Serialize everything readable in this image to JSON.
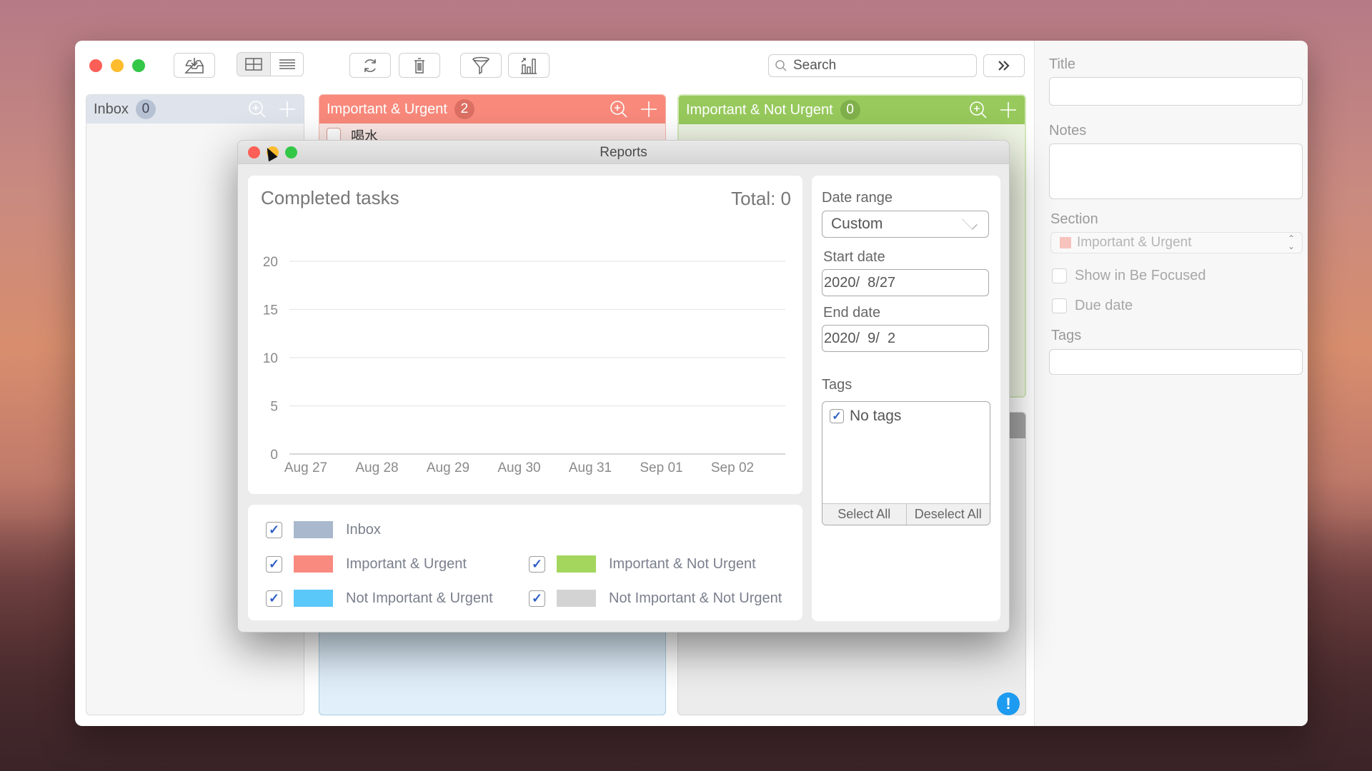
{
  "toolbar": {
    "search_placeholder": "Search",
    "icons": [
      "inbox-download-icon",
      "grid-view-icon",
      "list-view-icon",
      "refresh-icon",
      "trash-icon",
      "filter-icon",
      "reports-chart-icon",
      "expand-panel-icon"
    ]
  },
  "columns": {
    "inbox": {
      "label": "Inbox",
      "count": "0",
      "color": "#dfe4ec"
    },
    "important_urgent": {
      "label": "Important & Urgent",
      "count": "2",
      "color": "#f8897b",
      "tasks": [
        {
          "title": "喝水",
          "done": false
        }
      ]
    },
    "important_not_urgent": {
      "label": "Important & Not Urgent",
      "count": "0",
      "color": "#97c95c"
    }
  },
  "detail_panel": {
    "title_label": "Title",
    "title_value": "",
    "notes_label": "Notes",
    "notes_value": "",
    "section_label": "Section",
    "section_value": "Important & Urgent",
    "section_color": "#f7c3bd",
    "show_in_be_focused_label": "Show in Be Focused",
    "show_in_be_focused": false,
    "due_date_label": "Due date",
    "due_date": false,
    "tags_label": "Tags",
    "tags_value": ""
  },
  "reports": {
    "window_title": "Reports",
    "chart_title": "Completed tasks",
    "total_label": "Total: 0",
    "legend": [
      {
        "label": "Inbox",
        "color": "#a9b8cc",
        "checked": true
      },
      {
        "label": "Important & Urgent",
        "color": "#f98a80",
        "checked": true
      },
      {
        "label": "Important & Not Urgent",
        "color": "#a4d65e",
        "checked": true
      },
      {
        "label": "Not Important & Urgent",
        "color": "#5bc8fa",
        "checked": true
      },
      {
        "label": "Not Important & Not Urgent",
        "color": "#d3d3d3",
        "checked": true
      }
    ],
    "filters": {
      "date_range_label": "Date range",
      "date_range_value": "Custom",
      "start_date_label": "Start date",
      "start_date_value": "2020/  8/27",
      "end_date_label": "End date",
      "end_date_value": "2020/  9/  2",
      "tags_label": "Tags",
      "tags": [
        {
          "label": "No tags",
          "checked": true
        }
      ],
      "select_all_label": "Select All",
      "deselect_all_label": "Deselect All"
    }
  },
  "chart_data": {
    "type": "bar",
    "title": "Completed tasks",
    "categories": [
      "Aug 27",
      "Aug 28",
      "Aug 29",
      "Aug 30",
      "Aug 31",
      "Sep 01",
      "Sep 02"
    ],
    "series": [
      {
        "name": "Inbox",
        "values": [
          0,
          0,
          0,
          0,
          0,
          0,
          0
        ]
      },
      {
        "name": "Important & Urgent",
        "values": [
          0,
          0,
          0,
          0,
          0,
          0,
          0
        ]
      },
      {
        "name": "Important & Not Urgent",
        "values": [
          0,
          0,
          0,
          0,
          0,
          0,
          0
        ]
      },
      {
        "name": "Not Important & Urgent",
        "values": [
          0,
          0,
          0,
          0,
          0,
          0,
          0
        ]
      },
      {
        "name": "Not Important & Not Urgent",
        "values": [
          0,
          0,
          0,
          0,
          0,
          0,
          0
        ]
      }
    ],
    "yticks": [
      0,
      5,
      10,
      15,
      20
    ],
    "ylim": [
      0,
      20
    ],
    "xlabel": "",
    "ylabel": "",
    "grid": true,
    "legend": "bottom",
    "total": 0
  }
}
